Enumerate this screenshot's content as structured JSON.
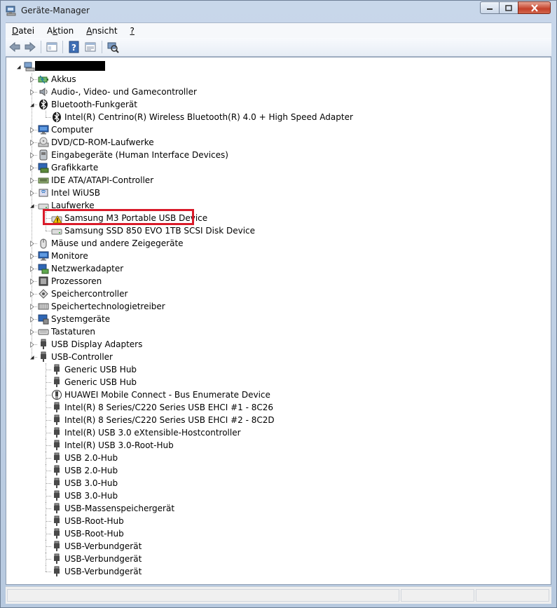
{
  "window": {
    "title": "Geräte-Manager"
  },
  "menu": [
    {
      "label": "Datei",
      "accel": "D"
    },
    {
      "label": "Aktion",
      "accel": "k"
    },
    {
      "label": "Ansicht",
      "accel": "A"
    },
    {
      "label": "?",
      "accel": "?"
    }
  ],
  "toolbar": {
    "icons": [
      "back-arrow-icon",
      "forward-arrow-icon",
      "properties-view-icon",
      "help-icon",
      "console-view-icon",
      "scan-hardware-icon"
    ]
  },
  "tree": {
    "root": {
      "label": "",
      "icon": "computer-root-icon"
    },
    "categories": [
      {
        "label": "Akkus",
        "icon": "battery-icon",
        "expanded": false,
        "children": []
      },
      {
        "label": "Audio-, Video- und Gamecontroller",
        "icon": "speaker-icon",
        "expanded": false,
        "children": []
      },
      {
        "label": "Bluetooth-Funkgerät",
        "icon": "bluetooth-icon",
        "expanded": true,
        "children": [
          {
            "label": "Intel(R) Centrino(R) Wireless Bluetooth(R) 4.0 + High Speed Adapter",
            "icon": "bluetooth-icon"
          }
        ]
      },
      {
        "label": "Computer",
        "icon": "monitor-icon",
        "expanded": false,
        "children": []
      },
      {
        "label": "DVD/CD-ROM-Laufwerke",
        "icon": "dvd-drive-icon",
        "expanded": false,
        "children": []
      },
      {
        "label": "Eingabegeräte (Human Interface Devices)",
        "icon": "hid-icon",
        "expanded": false,
        "children": []
      },
      {
        "label": "Grafikkarte",
        "icon": "display-adapter-icon",
        "expanded": false,
        "children": []
      },
      {
        "label": "IDE ATA/ATAPI-Controller",
        "icon": "ide-controller-icon",
        "expanded": false,
        "children": []
      },
      {
        "label": "Intel WiUSB",
        "icon": "wiusb-icon",
        "expanded": false,
        "children": []
      },
      {
        "label": "Laufwerke",
        "icon": "disk-drive-icon",
        "expanded": true,
        "children": [
          {
            "label": "Samsung M3 Portable USB Device",
            "icon": "disk-drive-warning-icon",
            "warning": true
          },
          {
            "label": "Samsung SSD 850 EVO 1TB SCSI Disk Device",
            "icon": "disk-drive-icon"
          }
        ]
      },
      {
        "label": "Mäuse und andere Zeigegeräte",
        "icon": "mouse-icon",
        "expanded": false,
        "children": []
      },
      {
        "label": "Monitore",
        "icon": "monitor-icon",
        "expanded": false,
        "children": []
      },
      {
        "label": "Netzwerkadapter",
        "icon": "network-adapter-icon",
        "expanded": false,
        "children": []
      },
      {
        "label": "Prozessoren",
        "icon": "processor-icon",
        "expanded": false,
        "children": []
      },
      {
        "label": "Speichercontroller",
        "icon": "storage-controller-icon",
        "expanded": false,
        "children": []
      },
      {
        "label": "Speichertechnologietreiber",
        "icon": "memory-tech-icon",
        "expanded": false,
        "children": []
      },
      {
        "label": "Systemgeräte",
        "icon": "system-device-icon",
        "expanded": false,
        "children": []
      },
      {
        "label": "Tastaturen",
        "icon": "keyboard-icon",
        "expanded": false,
        "children": []
      },
      {
        "label": "USB Display Adapters",
        "icon": "usb-plug-icon",
        "expanded": false,
        "children": []
      },
      {
        "label": "USB-Controller",
        "icon": "usb-plug-icon",
        "expanded": true,
        "children": [
          {
            "label": "Generic USB Hub",
            "icon": "usb-plug-icon"
          },
          {
            "label": "Generic USB Hub",
            "icon": "usb-plug-icon"
          },
          {
            "label": "HUAWEI Mobile Connect - Bus Enumerate Device",
            "icon": "usb-plug-info-icon"
          },
          {
            "label": "Intel(R) 8 Series/C220 Series USB EHCI #1 - 8C26",
            "icon": "usb-plug-icon"
          },
          {
            "label": "Intel(R) 8 Series/C220 Series USB EHCI #2 - 8C2D",
            "icon": "usb-plug-icon"
          },
          {
            "label": "Intel(R) USB 3.0 eXtensible-Hostcontroller",
            "icon": "usb-plug-icon"
          },
          {
            "label": "Intel(R) USB 3.0-Root-Hub",
            "icon": "usb-plug-icon"
          },
          {
            "label": "USB 2.0-Hub",
            "icon": "usb-plug-icon"
          },
          {
            "label": "USB 2.0-Hub",
            "icon": "usb-plug-icon"
          },
          {
            "label": "USB 3.0-Hub",
            "icon": "usb-plug-icon"
          },
          {
            "label": "USB 3.0-Hub",
            "icon": "usb-plug-icon"
          },
          {
            "label": "USB-Massenspeichergerät",
            "icon": "usb-plug-icon"
          },
          {
            "label": "USB-Root-Hub",
            "icon": "usb-plug-icon"
          },
          {
            "label": "USB-Root-Hub",
            "icon": "usb-plug-icon"
          },
          {
            "label": "USB-Verbundgerät",
            "icon": "usb-plug-icon"
          },
          {
            "label": "USB-Verbundgerät",
            "icon": "usb-plug-icon"
          },
          {
            "label": "USB-Verbundgerät",
            "icon": "usb-plug-icon"
          }
        ]
      }
    ]
  },
  "colors": {
    "highlight_border": "#d91b2a",
    "warning_yellow": "#f5c400"
  }
}
